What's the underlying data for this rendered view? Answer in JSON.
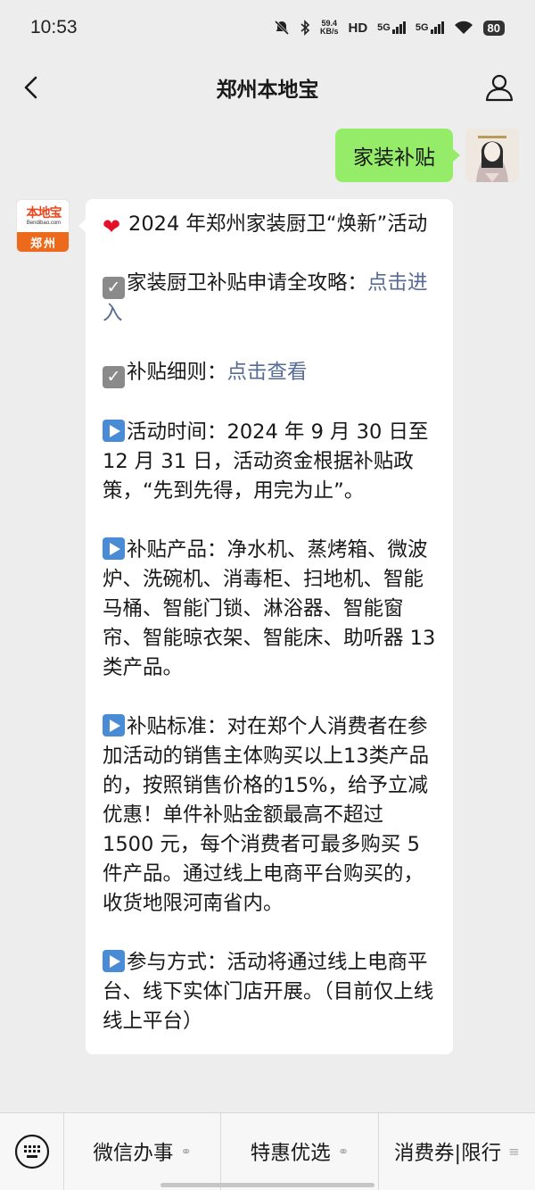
{
  "status_bar": {
    "time": "10:53",
    "net_speed_value": "59.4",
    "net_speed_unit": "KB/s",
    "hd": "HD",
    "sig1": "5G",
    "sig2": "5G",
    "battery": "80"
  },
  "nav": {
    "title": "郑州本地宝"
  },
  "outgoing": {
    "text": "家装补贴"
  },
  "bot_avatar": {
    "brand_cn": "本地宝",
    "brand_en": "Bendibao.com",
    "city": "郑州"
  },
  "reply": {
    "p1": "2024 年郑州家装厨卫“焕新”活动",
    "p2_text": "家装厨卫补贴申请全攻略：",
    "p2_link": "点击进入",
    "p3_text": "补贴细则：",
    "p3_link": "点击查看",
    "p4": "活动时间：2024 年 9 月 30 日至12 月 31 日，活动资金根据补贴政策，“先到先得，用完为止”。",
    "p5": "补贴产品：净水机、蒸烤箱、微波炉、洗碗机、消毒柜、扫地机、智能马桶、智能门锁、淋浴器、智能窗帘、智能晾衣架、智能床、助听器 13 类产品。",
    "p6": "补贴标准：对在郑个人消费者在参加活动的销售主体购买以上13类产品的，按照销售价格的15%，给予立减优惠！单件补贴金额最高不超过 1500 元，每个消费者可最多购买 5 件产品。通过线上电商平台购买的，收货地限河南省内。",
    "p7": "参与方式：活动将通过线上电商平台、线下实体门店开展。（目前仅上线线上平台）"
  },
  "menu": {
    "items": [
      {
        "label": "微信办事",
        "icon": "link-icon"
      },
      {
        "label": "特惠优选",
        "icon": "link-icon"
      },
      {
        "label": "消费券|限行",
        "icon": "menu-lines-icon"
      }
    ]
  }
}
